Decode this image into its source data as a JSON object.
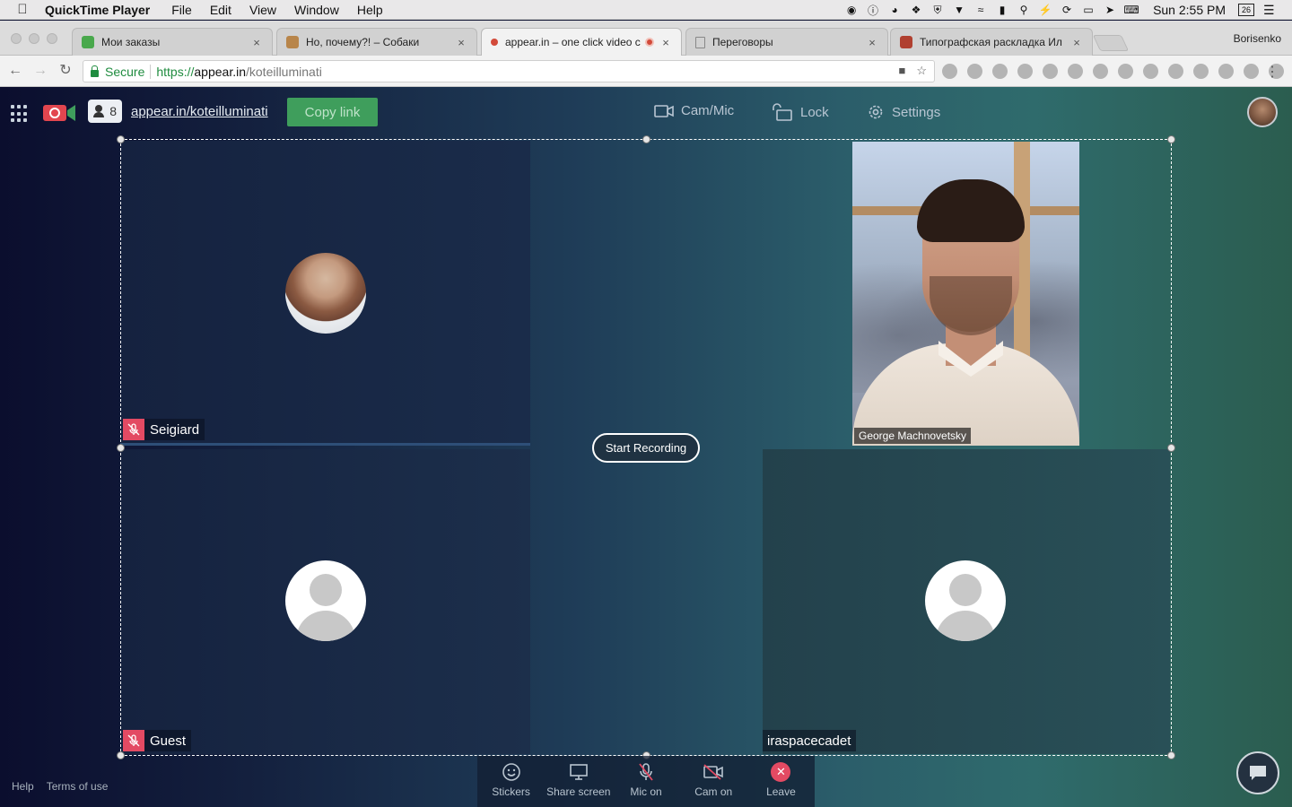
{
  "menubar": {
    "app_name": "QuickTime Player",
    "items": [
      "File",
      "Edit",
      "View",
      "Window",
      "Help"
    ],
    "clock": "Sun 2:55 PM",
    "calendar_day": "26"
  },
  "tabs": [
    {
      "label": "Мои заказы",
      "favicon_color": "#49a84c",
      "active": false
    },
    {
      "label": "Но, почему?! – Собаки",
      "favicon_color": "#b8854a",
      "active": false
    },
    {
      "label": "appear.in – one click video c",
      "favicon_color": "#d24a3a",
      "active": true,
      "recording": true
    },
    {
      "label": "Переговоры",
      "favicon_color": "#888888",
      "active": false
    },
    {
      "label": "Типографская раскладка Ил",
      "favicon_color": "#b04030",
      "active": false
    }
  ],
  "profile_name": "Borisenko",
  "address": {
    "secure_label": "Secure",
    "url_proto": "https://",
    "url_host": "appear.in",
    "url_path": "/koteilluminati"
  },
  "room": {
    "participant_count": "8",
    "room_link": "appear.in/koteilluminati",
    "copy_label": "Copy link",
    "cam_mic_label": "Cam/Mic",
    "lock_label": "Lock",
    "settings_label": "Settings"
  },
  "participants": {
    "seigiard": "Seigiard",
    "guest": "Guest",
    "ira": "iraspacecadet",
    "george": "George Machnovetsky"
  },
  "record_label": "Start Recording",
  "controls": {
    "stickers": "Stickers",
    "share_screen": "Share screen",
    "mic_on": "Mic on",
    "cam_on": "Cam on",
    "leave": "Leave"
  },
  "footer": {
    "help": "Help",
    "terms": "Terms of use"
  },
  "colors": {
    "accent_green": "#3f9e5c",
    "mute_red": "#e34a63",
    "secure_green": "#1f8c3f"
  }
}
